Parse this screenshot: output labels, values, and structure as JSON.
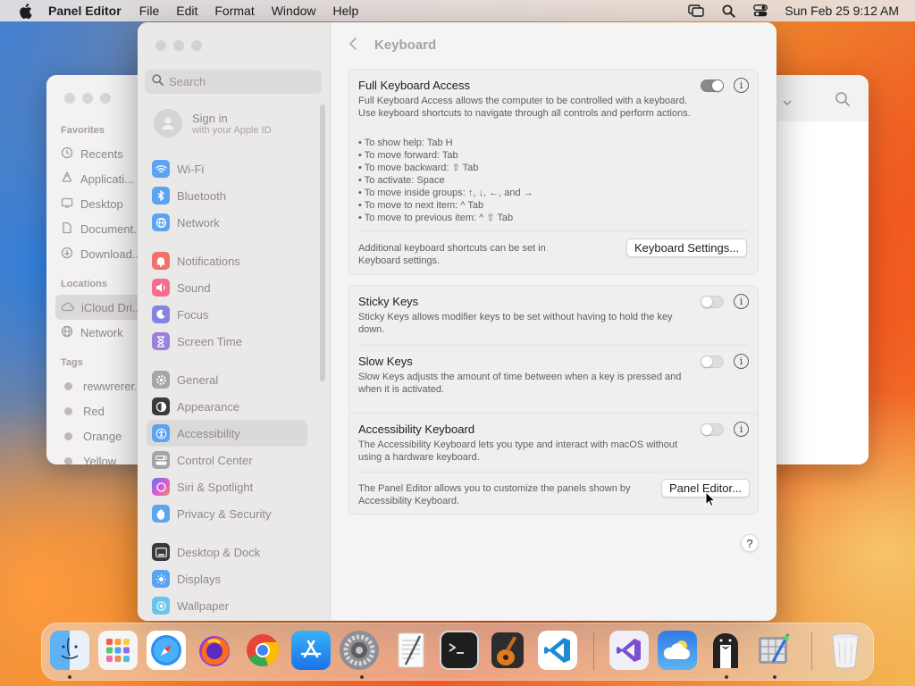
{
  "menubar": {
    "app_name": "Panel Editor",
    "menus": [
      "File",
      "Edit",
      "Format",
      "Window",
      "Help"
    ],
    "datetime": "Sun Feb 25  9:12 AM"
  },
  "finder": {
    "sections": {
      "favorites": "Favorites",
      "locations": "Locations",
      "tags": "Tags"
    },
    "favorites": [
      "Recents",
      "Applicati...",
      "Desktop",
      "Document...",
      "Download..."
    ],
    "locations": [
      "iCloud Dri...",
      "Network"
    ],
    "tags": [
      "rewwrerer...",
      "Red",
      "Orange",
      "Yellow"
    ]
  },
  "settings": {
    "search_placeholder": "Search",
    "signin": {
      "title": "Sign in",
      "subtitle": "with your Apple ID"
    },
    "nav": [
      {
        "label": "Wi-Fi",
        "icon": "wifi-icon",
        "color": "#3b8cf0"
      },
      {
        "label": "Bluetooth",
        "icon": "bluetooth-icon",
        "color": "#3b8cf0"
      },
      {
        "label": "Network",
        "icon": "network-globe-icon",
        "color": "#3b8cf0"
      },
      {
        "label": "Notifications",
        "icon": "notifications-bell-icon",
        "color": "#ef4b3e"
      },
      {
        "label": "Sound",
        "icon": "sound-speaker-icon",
        "color": "#ef4570"
      },
      {
        "label": "Focus",
        "icon": "focus-moon-icon",
        "color": "#5c58d6"
      },
      {
        "label": "Screen Time",
        "icon": "screen-time-hourglass-icon",
        "color": "#7a57d0"
      },
      {
        "label": "General",
        "icon": "general-gear-icon",
        "color": "#8e8e93"
      },
      {
        "label": "Appearance",
        "icon": "appearance-icon",
        "color": "#1d1d1f"
      },
      {
        "label": "Accessibility",
        "icon": "accessibility-icon",
        "color": "#3b8cf0"
      },
      {
        "label": "Control Center",
        "icon": "control-center-icon",
        "color": "#8e8e93"
      },
      {
        "label": "Siri & Spotlight",
        "icon": "siri-icon",
        "color": "#c048c8"
      },
      {
        "label": "Privacy & Security",
        "icon": "privacy-hand-icon",
        "color": "#3b8cf0"
      },
      {
        "label": "Desktop & Dock",
        "icon": "desktop-dock-icon",
        "color": "#1d1d1f"
      },
      {
        "label": "Displays",
        "icon": "displays-sun-icon",
        "color": "#3b8cf0"
      },
      {
        "label": "Wallpaper",
        "icon": "wallpaper-icon",
        "color": "#38b6e8"
      }
    ],
    "selected_nav": "Accessibility",
    "page_title": "Keyboard",
    "full_keyboard_access": {
      "heading": "Full Keyboard Access",
      "description": "Full Keyboard Access allows the computer to be controlled with a keyboard. Use keyboard shortcuts to navigate through all controls and perform actions.",
      "shortcuts": [
        "• To show help: Tab H",
        "• To move forward: Tab",
        "• To move backward: ⇧ Tab",
        "• To activate: Space",
        "• To move inside groups: ↑, ↓, ←, and →",
        "• To move to next item: ^ Tab",
        "• To move to previous item: ^ ⇧ Tab"
      ],
      "enabled": true,
      "additional_text": "Additional keyboard shortcuts can be set in Keyboard settings.",
      "button": "Keyboard Settings..."
    },
    "sticky_keys": {
      "heading": "Sticky Keys",
      "description": "Sticky Keys allows modifier keys to be set without having to hold the key down.",
      "enabled": false
    },
    "slow_keys": {
      "heading": "Slow Keys",
      "description": "Slow Keys adjusts the amount of time between when a key is pressed and when it is activated.",
      "enabled": false
    },
    "accessibility_keyboard": {
      "heading": "Accessibility Keyboard",
      "description": "The Accessibility Keyboard lets you type and interact with macOS without using a hardware keyboard.",
      "enabled": false,
      "panel_text": "The Panel Editor allows you to customize the panels shown by Accessibility Keyboard.",
      "button": "Panel Editor..."
    },
    "help_label": "?",
    "info_glyph": "i"
  },
  "dock": {
    "apps": [
      {
        "name": "Finder",
        "icon": "finder-icon",
        "running": true
      },
      {
        "name": "Launchpad",
        "icon": "launchpad-icon",
        "running": false
      },
      {
        "name": "Safari",
        "icon": "safari-icon",
        "running": false
      },
      {
        "name": "Firefox",
        "icon": "firefox-icon",
        "running": false
      },
      {
        "name": "Chrome",
        "icon": "chrome-icon",
        "running": false
      },
      {
        "name": "App Store",
        "icon": "app-store-icon",
        "running": false
      },
      {
        "name": "System Settings",
        "icon": "system-settings-icon",
        "running": true
      },
      {
        "name": "TextEdit",
        "icon": "textedit-icon",
        "running": false
      },
      {
        "name": "Terminal",
        "icon": "terminal-icon",
        "running": false
      },
      {
        "name": "GarageBand",
        "icon": "garageband-icon",
        "running": false
      },
      {
        "name": "VS Code",
        "icon": "vscode-icon",
        "running": false
      },
      {
        "name": "Visual Studio",
        "icon": "visual-studio-icon",
        "running": false
      },
      {
        "name": "Weather",
        "icon": "weather-icon",
        "running": false
      },
      {
        "name": "Bartender",
        "icon": "bartender-icon",
        "running": true
      },
      {
        "name": "Panel Editor",
        "icon": "panel-editor-icon",
        "running": true
      },
      {
        "name": "Trash",
        "icon": "trash-icon",
        "running": false
      }
    ]
  }
}
